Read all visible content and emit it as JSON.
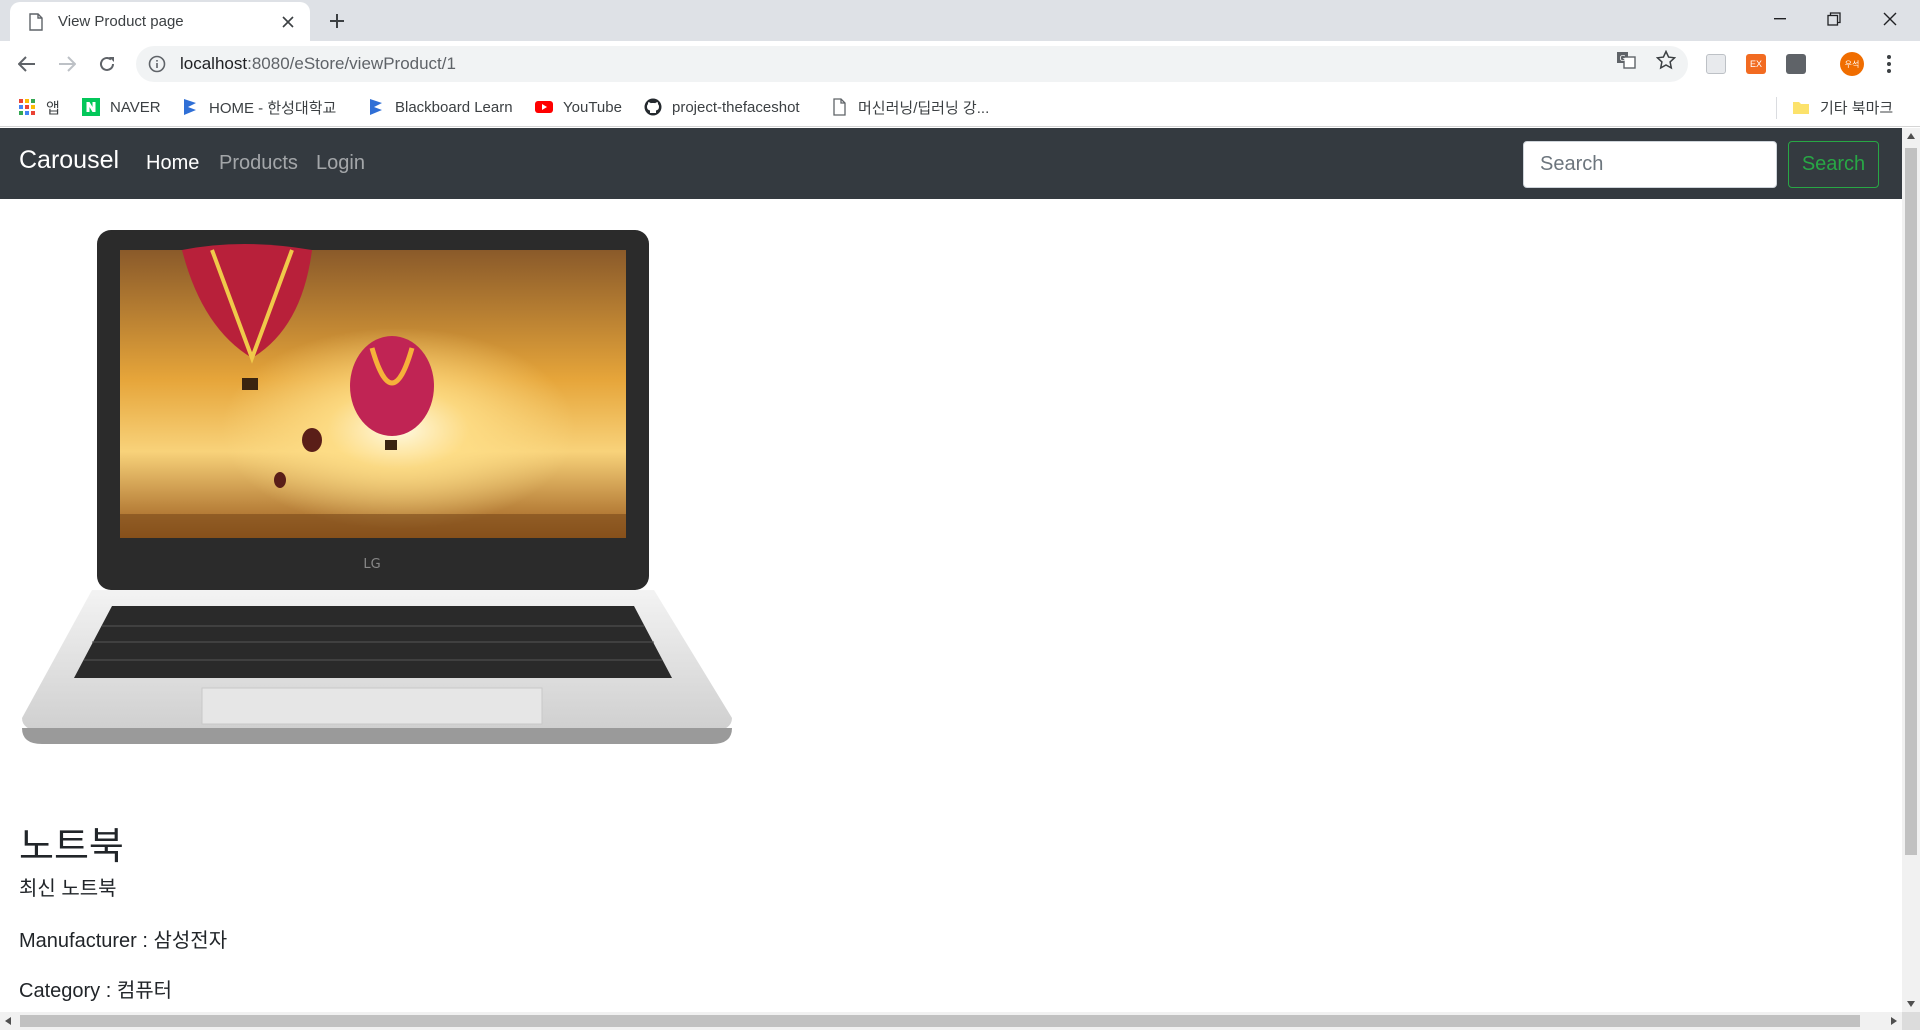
{
  "browser": {
    "tab_title": "View Product page",
    "url_host": "localhost",
    "url_path": ":8080/eStore/viewProduct/1",
    "profile_initials": "우석",
    "ext_label": "EX"
  },
  "bookmarks": [
    {
      "label": "앱",
      "icon": "apps-grid-icon"
    },
    {
      "label": "NAVER",
      "icon": "naver-icon"
    },
    {
      "label": "HOME - 한성대학교",
      "icon": "blackboard-icon"
    },
    {
      "label": "Blackboard Learn",
      "icon": "blackboard-icon"
    },
    {
      "label": "YouTube",
      "icon": "youtube-icon"
    },
    {
      "label": "project-thefaceshot",
      "icon": "github-icon"
    },
    {
      "label": "머신러닝/딥러닝 강...",
      "icon": "page-icon"
    }
  ],
  "other_bookmarks": "기타 북마크",
  "navbar": {
    "brand": "Carousel",
    "links": [
      "Home",
      "Products",
      "Login"
    ],
    "search_placeholder": "Search",
    "search_button": "Search"
  },
  "product": {
    "name": "노트북",
    "description": "최신 노트북",
    "manufacturer_line": "Manufacturer : 삼성전자",
    "category_line": "Category : 컴퓨터"
  },
  "colors": {
    "navbar_bg": "#343a40",
    "search_btn": "#28a745"
  }
}
